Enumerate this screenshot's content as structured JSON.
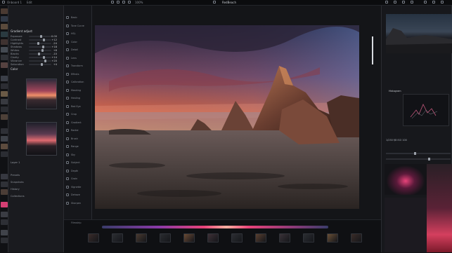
{
  "app": {
    "title": "RedBeach",
    "menu": [
      "Onboard 1",
      "Edit"
    ],
    "zoom": "100%"
  },
  "left_panel": {
    "section1": "Gradient adjust",
    "section2": "Color",
    "rows": [
      {
        "label": "Exposure",
        "value": "0.00"
      },
      {
        "label": "Contrast",
        "value": "+12"
      },
      {
        "label": "Highlights",
        "value": "-24"
      },
      {
        "label": "Shadows",
        "value": "+18"
      },
      {
        "label": "Whites",
        "value": "+6"
      },
      {
        "label": "Blacks",
        "value": "-10"
      },
      {
        "label": "Clarity",
        "value": "+14"
      },
      {
        "label": "Vibrance",
        "value": "+20"
      },
      {
        "label": "Saturation",
        "value": "+4"
      }
    ],
    "layer_label": "Layer 1",
    "footer_items": [
      "Presets",
      "Snapshots",
      "History",
      "Collections"
    ]
  },
  "tools": [
    {
      "label": "Basic"
    },
    {
      "label": "Tone Curve"
    },
    {
      "label": "HSL"
    },
    {
      "label": "Color"
    },
    {
      "label": "Detail"
    },
    {
      "label": "Lens"
    },
    {
      "label": "Transform"
    },
    {
      "label": "Effects"
    },
    {
      "label": "Calibration"
    },
    {
      "label": "Masking"
    },
    {
      "label": "Healing"
    },
    {
      "label": "Red Eye"
    },
    {
      "label": "Crop"
    },
    {
      "label": "Gradient"
    },
    {
      "label": "Radial"
    },
    {
      "label": "Brush"
    },
    {
      "label": "Range"
    },
    {
      "label": "Sky"
    },
    {
      "label": "Subject"
    },
    {
      "label": "Depth"
    },
    {
      "label": "Grain"
    },
    {
      "label": "Vignette"
    },
    {
      "label": "Dehaze"
    },
    {
      "label": "Sharpen"
    }
  ],
  "right_panel": {
    "histogram_label": "Histogram",
    "readout": "1/250  f/8  ISO 100"
  },
  "filmstrip": {
    "label": "Filmstrip",
    "count": 12
  },
  "colors": {
    "accent": "#e8437a",
    "bg": "#121316",
    "panel": "#1a1b1f"
  }
}
